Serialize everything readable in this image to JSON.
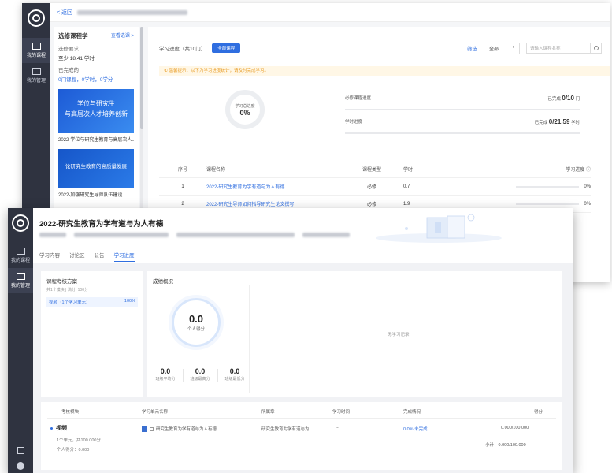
{
  "rail": {
    "items": [
      {
        "label": "我的课程"
      },
      {
        "label": "我的管理"
      }
    ]
  },
  "back": {
    "topbar": {
      "back_label": "< 返回"
    },
    "course_panel": {
      "title": "选修课程学",
      "link": "查看选课 >",
      "req_label": "选修要求",
      "req_value": "至少 18.41 学时",
      "done_label": "已完成的",
      "done_value": "0门课程，0学时，0学分",
      "banner1_line1": "学位与研究生",
      "banner1_line2": "与高层次人才培养创新",
      "caption1": "2022-学位与研究生教育与高层次人...",
      "banner2_line1": "论研究生教育的高质量发展",
      "caption2": "2022-加强研究生导师队伍建设"
    },
    "main": {
      "toolbar_label": "学习进度（共10门）",
      "toolbar_button": "全部课程",
      "filter_link": "筛选",
      "select_value": "全部",
      "search_placeholder": "请输入课程名称",
      "notice": "① 温馨提示：以下为学习进度统计，请及时完成学习。",
      "ring_label": "学习总进度",
      "ring_value": "0%",
      "progress_rows": [
        {
          "label": "必修课程进度",
          "value": "0/10",
          "prefix": "已完成",
          "unit": "门"
        },
        {
          "label": "学时进度",
          "value": "0/21.59",
          "prefix": "已完成",
          "unit": "学时"
        }
      ],
      "table": {
        "headers": [
          "序号",
          "课程名称",
          "课程类型",
          "学时",
          "学习进度 ⓘ"
        ],
        "rows": [
          {
            "no": "1",
            "name": "2022-研究生教育为学有道与为人有德",
            "type": "必修",
            "hours": "0.7",
            "progress": "0%"
          },
          {
            "no": "2",
            "name": "2022-研究生导师如何指导研究生论文撰写",
            "type": "必修",
            "hours": "1.9",
            "progress": "0%"
          }
        ]
      }
    }
  },
  "front": {
    "title": "2022-研究生教育为学有道与为人有德",
    "tabs": [
      "学习内容",
      "讨论区",
      "公告",
      "学习进度"
    ],
    "active_tab": 3,
    "plan": {
      "title": "课程考核方案",
      "subtitle": "共1个模块 | 满分: 100分",
      "row_label": "视频（1个学习单元）",
      "row_value": "100%"
    },
    "score": {
      "title": "成绩概况",
      "ring_value": "0.0",
      "ring_label": "个人得分",
      "stats": [
        {
          "value": "0.0",
          "label": "班级平均分"
        },
        {
          "value": "0.0",
          "label": "班级最高分"
        },
        {
          "value": "0.0",
          "label": "班级最低分"
        }
      ],
      "empty_text": "无学习记录"
    },
    "list": {
      "headers": [
        "考核模块",
        "学习单元名称",
        "所属章",
        "学习时间",
        "完成情况",
        "得分"
      ],
      "module_name": "视频",
      "module_sub1": "1个单元，共100.000分",
      "module_sub2": "个人得分：0.000",
      "unit_name": "研究生教育为学有道与为人有德",
      "chapter": "研究生教育为学有道与为...",
      "time": "--",
      "completion": "0.0% 未完成",
      "score": "0.000/100.000",
      "subtotal": "小计：0.000/100.000"
    }
  }
}
